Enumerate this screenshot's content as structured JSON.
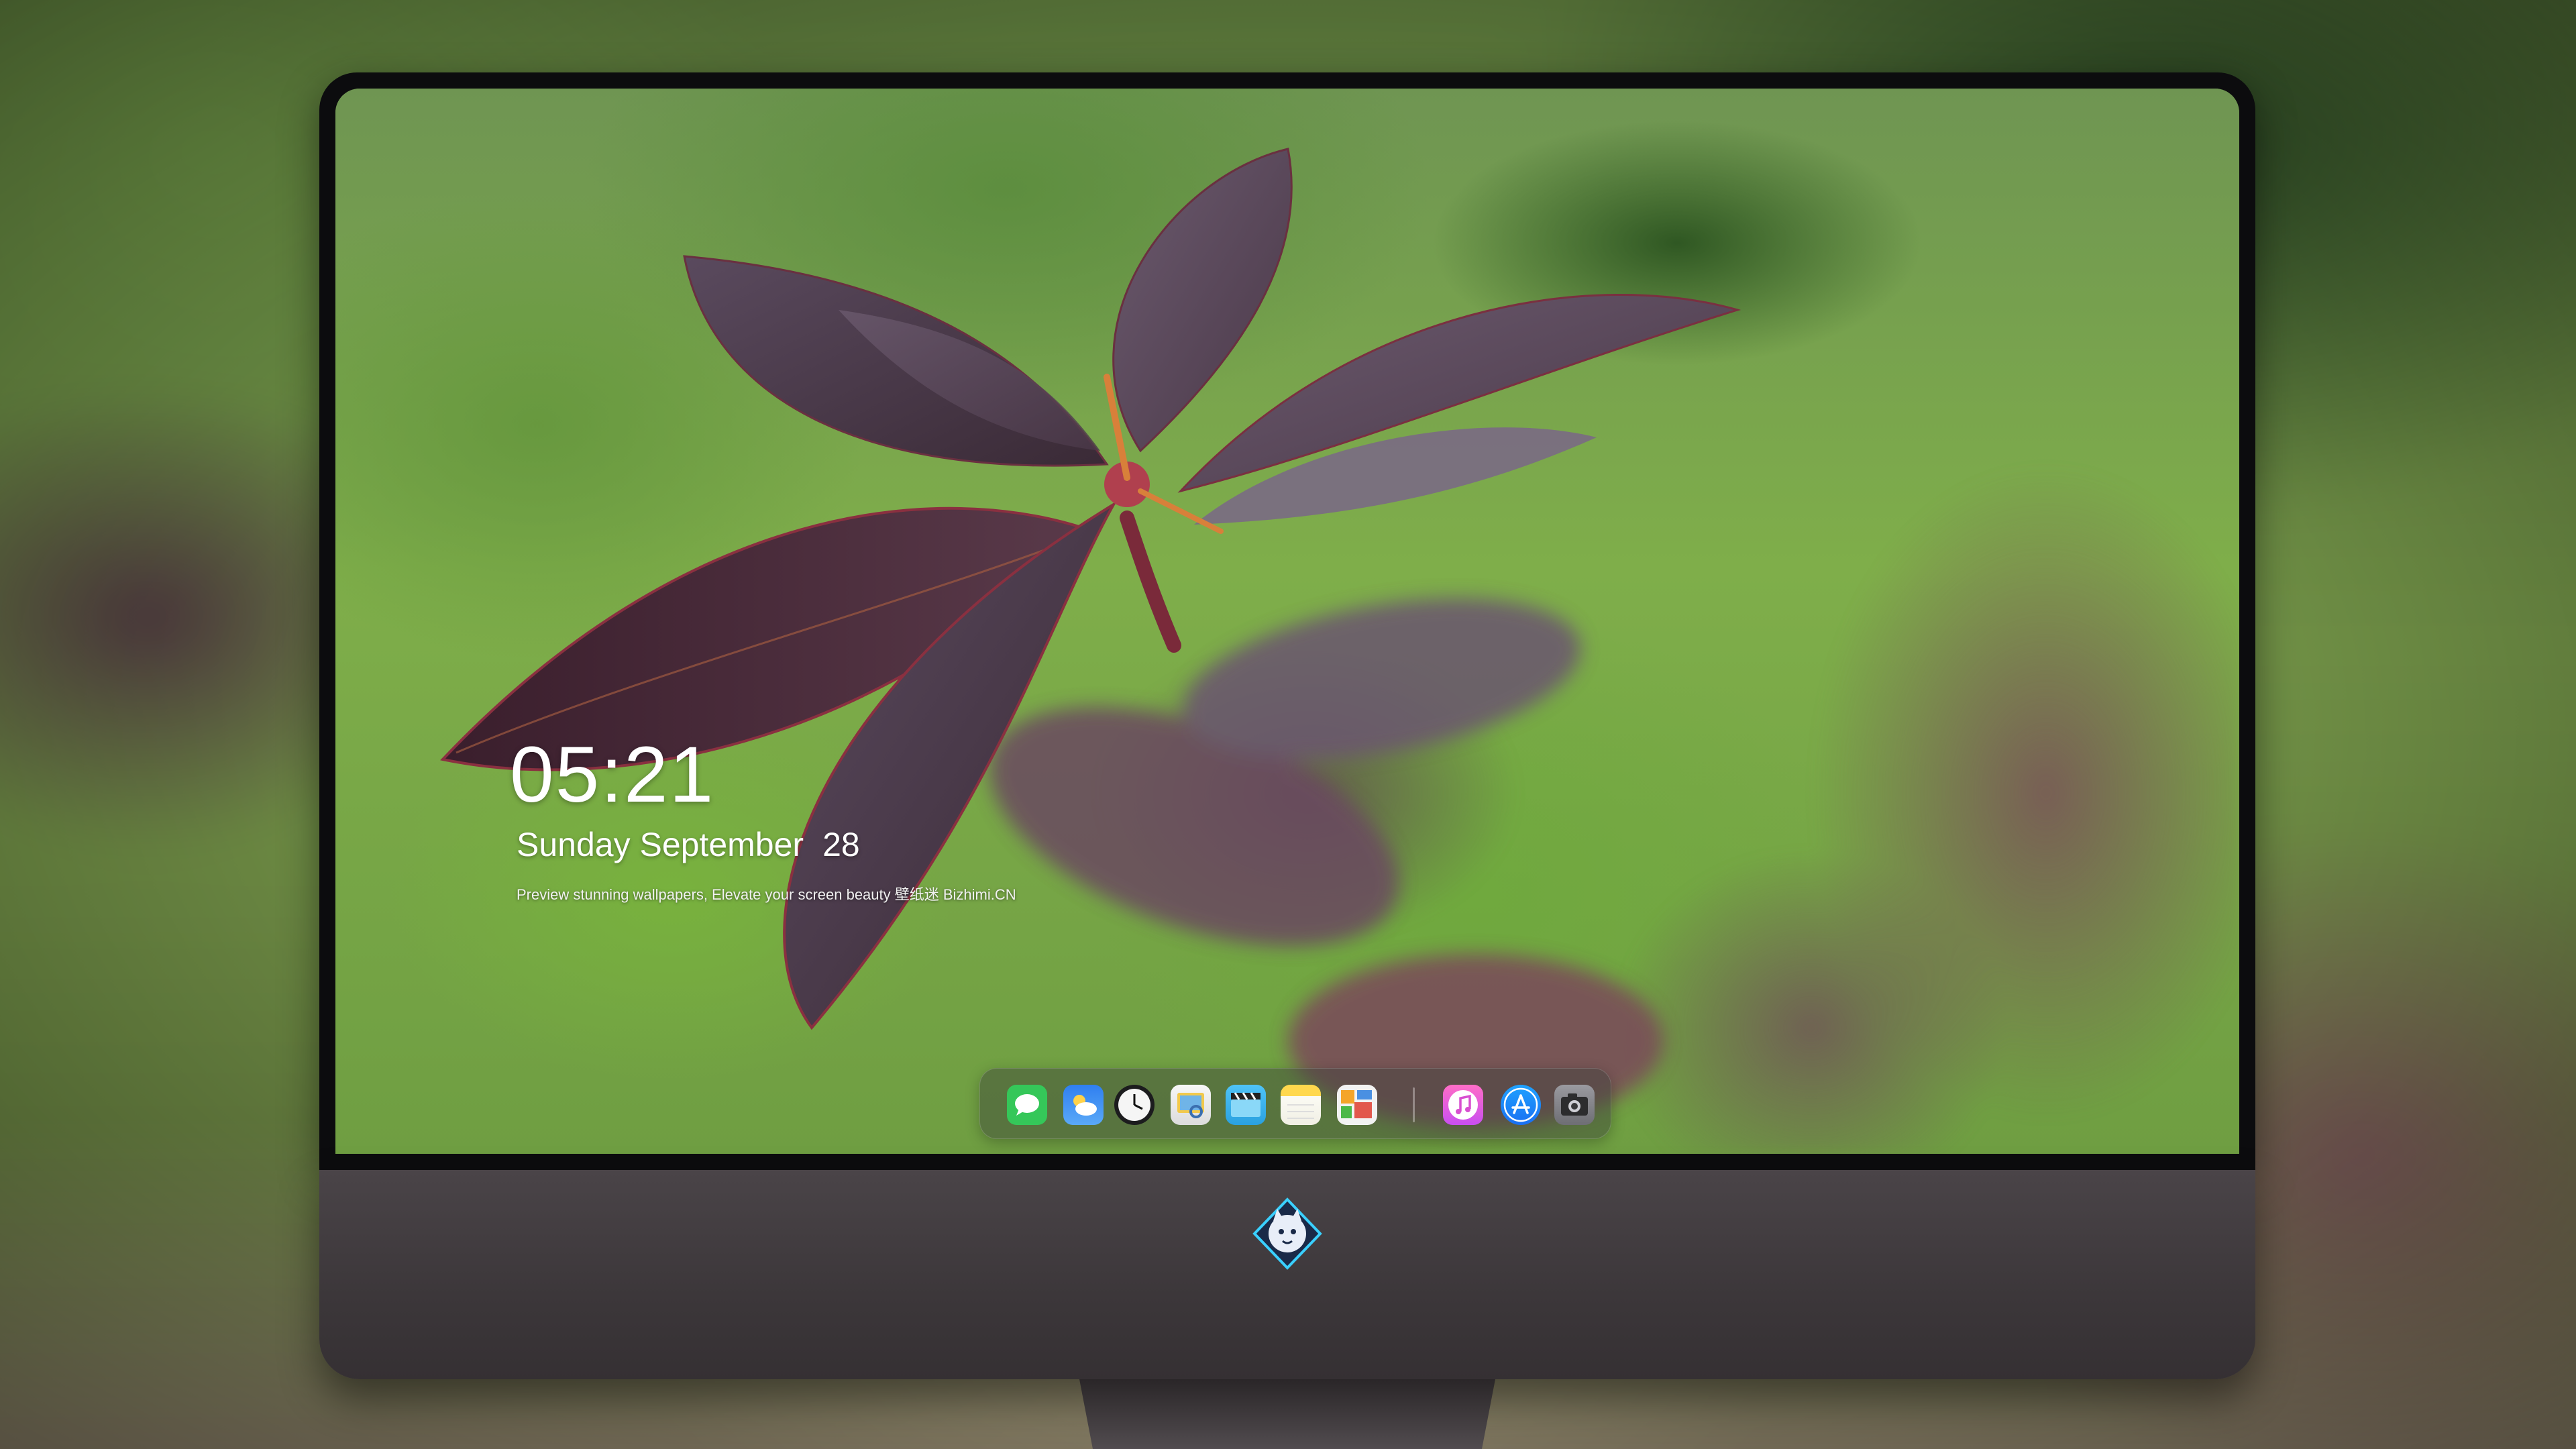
{
  "lock_screen": {
    "time": "05:21",
    "date_day": "Sunday September",
    "date_number": "28",
    "tagline": "Preview stunning wallpapers, Elevate your screen beauty  壁纸迷  Bizhimi.CN"
  },
  "dock": {
    "apps": [
      {
        "name": "messages-icon",
        "color": "#35c759"
      },
      {
        "name": "weather-icon",
        "color": "#3a8ff0"
      },
      {
        "name": "clock-icon",
        "color": "#1c1c1e"
      },
      {
        "name": "preview-icon",
        "color": "#f2c94c"
      },
      {
        "name": "video-clips-icon",
        "color": "#4fc3f7"
      },
      {
        "name": "notes-icon",
        "color": "#ffd84d"
      },
      {
        "name": "photo-board-icon",
        "color": "#f2f2f2"
      },
      {
        "name": "music-icon",
        "color": "#ef58e4"
      },
      {
        "name": "app-store-icon",
        "color": "#1e88f5"
      },
      {
        "name": "camera-icon",
        "color": "#8e8e93"
      }
    ]
  },
  "monitor": {
    "chin_logo": "fox-mascot-logo"
  }
}
